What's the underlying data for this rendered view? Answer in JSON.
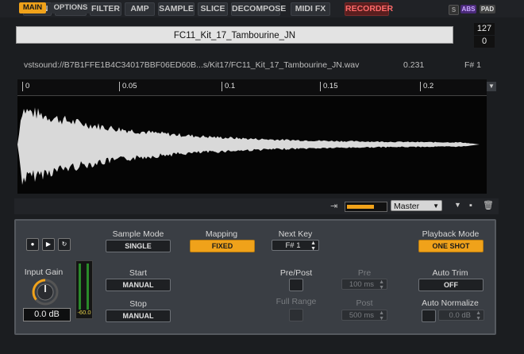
{
  "top_tabs": [
    "MAIN",
    "PITCH",
    "FILTER",
    "AMP",
    "SAMPLE",
    "SLICE",
    "DECOMPOSE",
    "MIDI FX"
  ],
  "recorder_label": "RECORDER",
  "mini_buttons": {
    "s": "S",
    "abs": "ABS",
    "pad": "PAD"
  },
  "sample_name": "FC11_Kit_17_Tambourine_JN",
  "range_high": "127",
  "range_low": "0",
  "path": "vstsound://B7B1FFE1B4C34017BBF06ED60B...s/Kit17/FC11_Kit_17_Tambourine_JN.wav",
  "position_readout": "0.231",
  "key_readout": "F# 1",
  "ruler_ticks": [
    "0",
    "0.05",
    "0.1",
    "0.15",
    "0.2"
  ],
  "sub_tabs": {
    "main": "MAIN",
    "options": "OPTIONS"
  },
  "output_select": "Master",
  "sample_mode": {
    "label": "Sample Mode",
    "value": "SINGLE"
  },
  "mapping": {
    "label": "Mapping",
    "value": "FIXED"
  },
  "next_key": {
    "label": "Next Key",
    "value": "F# 1"
  },
  "playback_mode": {
    "label": "Playback Mode",
    "value": "ONE SHOT"
  },
  "input_gain": {
    "label": "Input Gain",
    "value": "0.0 dB"
  },
  "meter_value": "-60.0",
  "start": {
    "label": "Start",
    "value": "MANUAL"
  },
  "stop": {
    "label": "Stop",
    "value": "MANUAL"
  },
  "pre_post": {
    "label": "Pre/Post"
  },
  "full_range": {
    "label": "Full Range"
  },
  "pre": {
    "label": "Pre",
    "value": "100 ms"
  },
  "post": {
    "label": "Post",
    "value": "500 ms"
  },
  "auto_trim": {
    "label": "Auto Trim",
    "value": "OFF"
  },
  "auto_normalize": {
    "label": "Auto Normalize",
    "value": "0.0 dB"
  },
  "colors": {
    "accent": "#f0a21a",
    "recorder": "#ff6a6a",
    "waveform": "#d9d9d9"
  }
}
